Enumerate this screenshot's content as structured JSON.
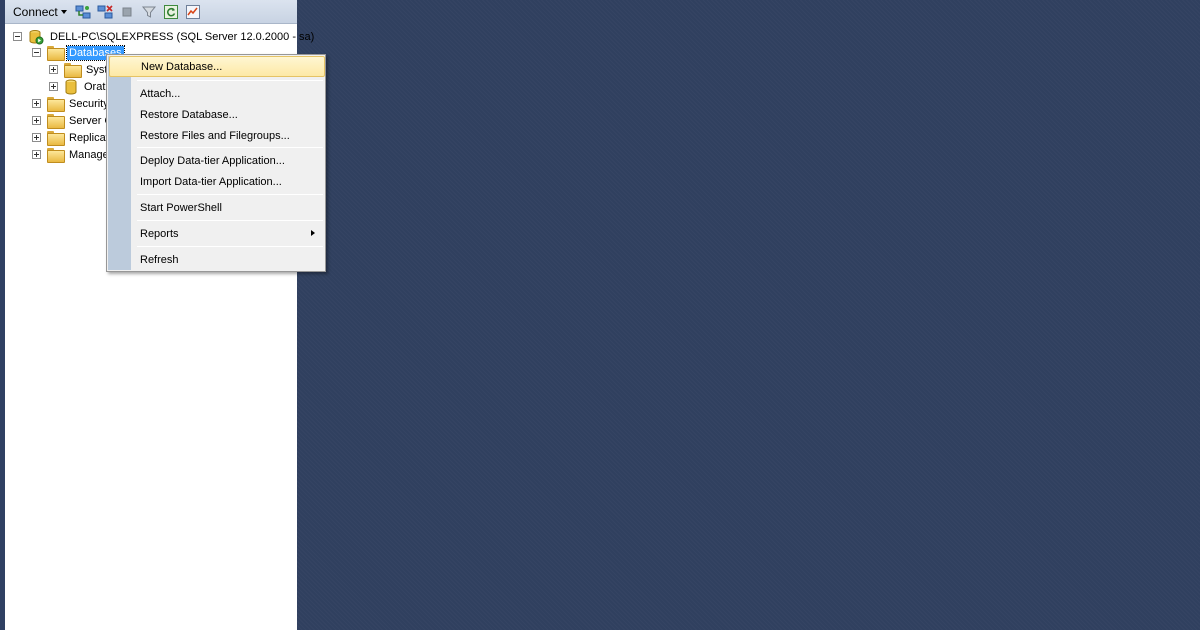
{
  "toolbar": {
    "connect_label": "Connect",
    "icons": [
      "connect-object-explorer-icon",
      "disconnect-icon",
      "stop-icon",
      "filter-icon",
      "refresh-icon",
      "activity-monitor-icon"
    ]
  },
  "tree": {
    "server": "DELL-PC\\SQLEXPRESS (SQL Server 12.0.2000 - sa)",
    "databases": "Databases",
    "system": "Syste",
    "orat": "Orati",
    "security": "Security",
    "server_objects": "Server O",
    "replication": "Replicati",
    "management": "Manage"
  },
  "context_menu": {
    "new_database": "New Database...",
    "attach": "Attach...",
    "restore_database": "Restore Database...",
    "restore_files": "Restore Files and Filegroups...",
    "deploy_dac": "Deploy Data-tier Application...",
    "import_dac": "Import Data-tier Application...",
    "start_powershell": "Start PowerShell",
    "reports": "Reports",
    "refresh": "Refresh"
  },
  "colors": {
    "workspace_bg": "#30405f",
    "selection": "#3399ff",
    "menu_hover": "#fde9a6",
    "menu_gutter": "#bccbdc"
  }
}
